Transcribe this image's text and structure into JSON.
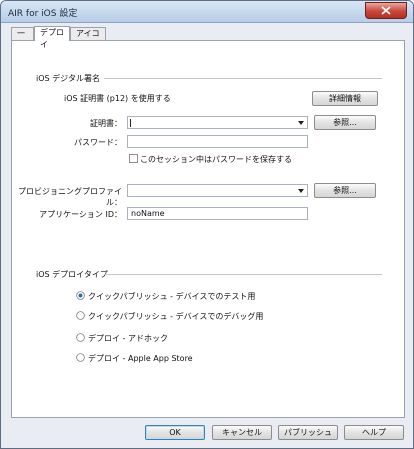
{
  "window": {
    "title": "AIR for iOS 設定"
  },
  "tabs": [
    {
      "label": "一般"
    },
    {
      "label": "デプロイ"
    },
    {
      "label": "アイコン"
    }
  ],
  "signing": {
    "section_title": "iOS デジタル署名",
    "use_cert_text": "iOS 証明書 (p12) を使用する",
    "details_button": "詳細情報",
    "cert_label": "証明書：",
    "cert_value": "",
    "browse_button": "参照...",
    "password_label": "パスワード：",
    "password_value": "",
    "remember_label": "このセッション中はパスワードを保存する",
    "remember_checked": false,
    "profile_label": "プロビジョニングプロファイル：",
    "profile_value": "",
    "profile_browse_button": "参照...",
    "appid_label": "アプリケーション ID：",
    "appid_value": "noName"
  },
  "deploy_type": {
    "section_title": "iOS デプロイタイプ",
    "options": [
      {
        "label": "クイックパブリッシュ - デバイスでのテスト用",
        "selected": true
      },
      {
        "label": "クイックパブリッシュ - デバイスでのデバッグ用",
        "selected": false
      },
      {
        "label": "デプロイ - アドホック",
        "selected": false
      },
      {
        "label": "デプロイ - Apple App Store",
        "selected": false
      }
    ]
  },
  "footer": {
    "ok_button": "OK",
    "cancel_button": "キャンセル",
    "publish_button": "パブリッシュ",
    "help_button": "ヘルプ"
  }
}
